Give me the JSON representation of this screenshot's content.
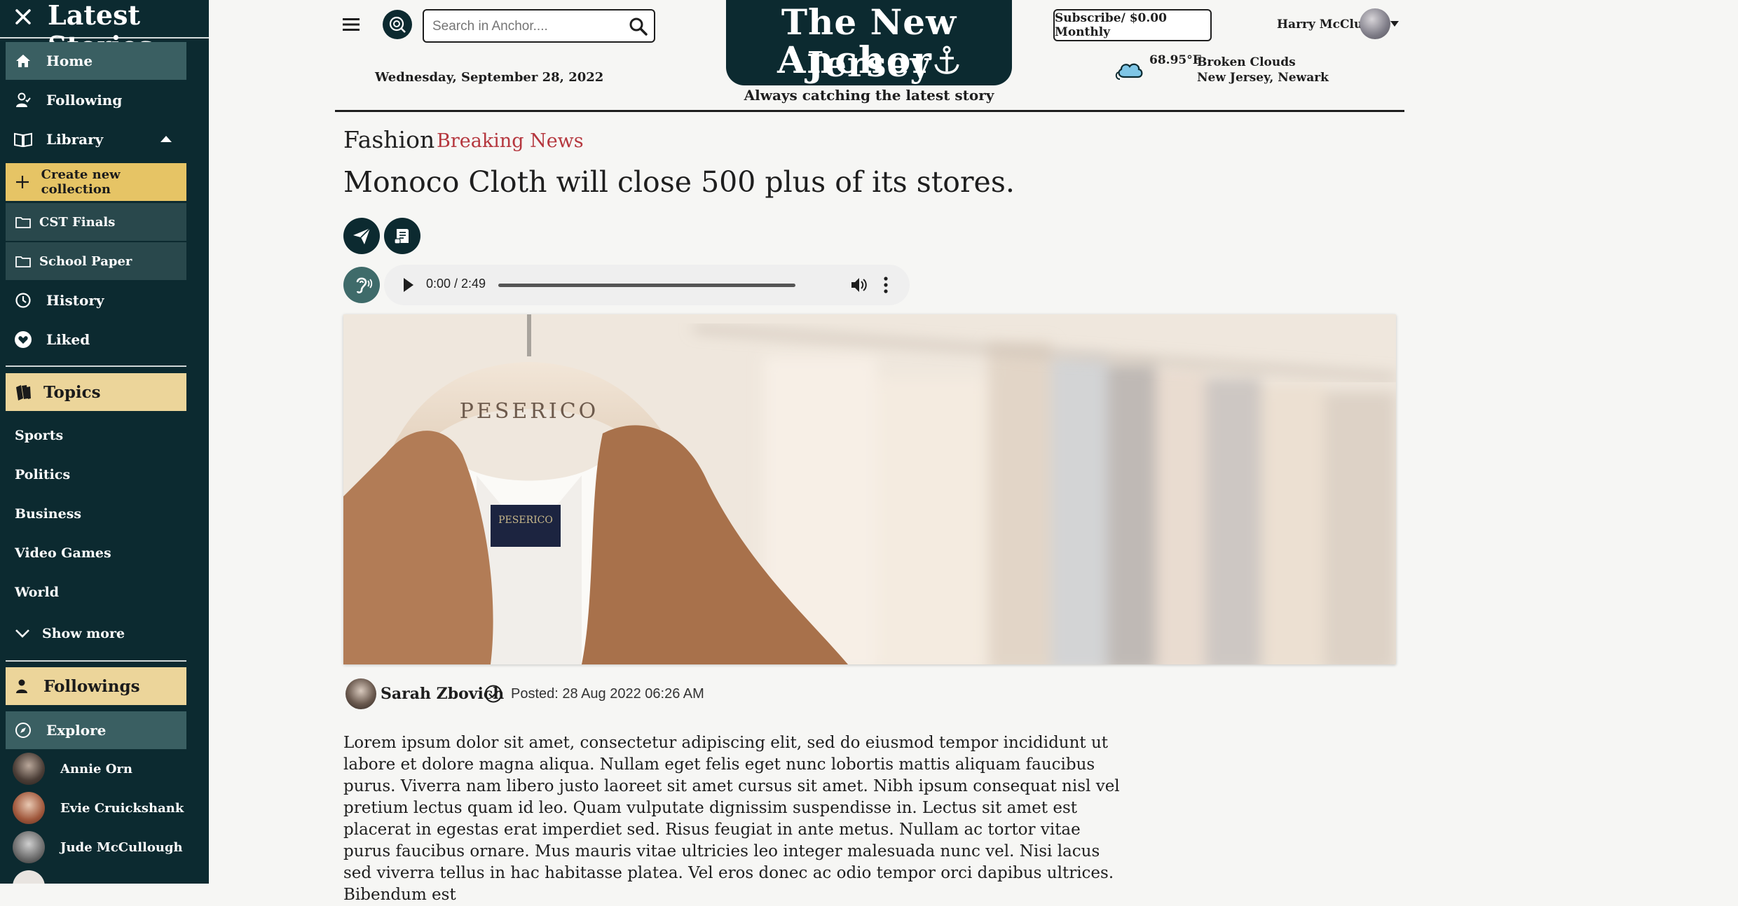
{
  "sidebar": {
    "title": "Latest Stories",
    "nav": [
      {
        "label": "Home",
        "icon": "home-icon"
      },
      {
        "label": "Following",
        "icon": "following-icon"
      },
      {
        "label": "Library",
        "icon": "library-icon"
      }
    ],
    "create_collection": "Create new collection",
    "collections": [
      "CST Finals",
      "School Paper"
    ],
    "history": "History",
    "liked": "Liked",
    "topics_header": "Topics",
    "topics": [
      "Sports",
      "Politics",
      "Business",
      "Video Games",
      "World"
    ],
    "show_more": "Show more",
    "followings_header": "Followings",
    "explore": "Explore",
    "followings": [
      "Annie Orn",
      "Evie Cruickshank",
      "Jude McCullough"
    ]
  },
  "header": {
    "search_placeholder": "Search in Anchor....",
    "date": "Wednesday, September 28, 2022",
    "masthead_line1": "The New Jersey",
    "masthead_line2": "Anchor",
    "tagline": "Always catching the latest story",
    "subscribe": "Subscribe/ $0.00 Monthly",
    "weather": {
      "temp": "68.95°F",
      "condition": "Broken Clouds",
      "location": "New Jersey, Newark"
    },
    "user_name": "Harry McClure"
  },
  "article": {
    "category": "Fashion",
    "badge": "Breaking News",
    "headline": "Monoco Cloth will close 500 plus of its stores.",
    "audio_time": "0:00 / 2:49",
    "author": "Sarah Zbovich",
    "posted": "Posted: 28 Aug 2022 06:26 AM",
    "hanger_brand": "PESERICO",
    "body": "Lorem ipsum dolor sit amet, consectetur adipiscing elit, sed do eiusmod tempor incididunt ut labore et dolore magna aliqua. Nullam eget felis eget nunc lobortis mattis aliquam faucibus purus. Viverra nam libero justo laoreet sit amet cursus sit amet. Nibh ipsum consequat nisl vel pretium lectus quam id leo. Quam vulputate dignissim suspendisse in. Lectus sit amet est placerat in egestas erat imperdiet sed. Risus feugiat in ante metus. Nullam ac tortor vitae purus faucibus ornare. Mus mauris vitae ultricies leo integer malesuada nunc vel. Nisi lacus sed viverra tellus in hac habitasse platea. Vel eros donec ac odio tempor orci dapibus ultrices. Bibendum est"
  },
  "colors": {
    "sidebar": "#0c2a30",
    "gold": "#e6c465",
    "breaking": "#b5373e"
  }
}
